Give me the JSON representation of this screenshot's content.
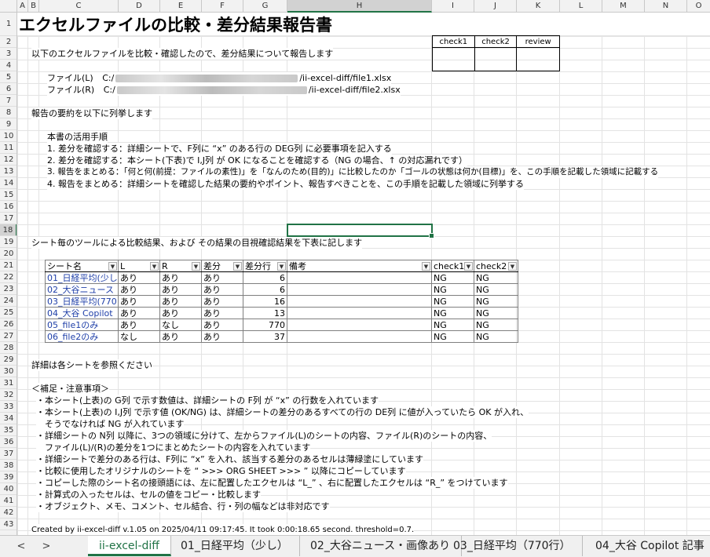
{
  "columns": [
    "A",
    "B",
    "C",
    "D",
    "E",
    "F",
    "G",
    "H",
    "I",
    "J",
    "K",
    "L",
    "M",
    "N",
    "O"
  ],
  "rows": [
    "1",
    "2",
    "3",
    "4",
    "5",
    "6",
    "7",
    "8",
    "9",
    "10",
    "11",
    "12",
    "13",
    "14",
    "15",
    "16",
    "17",
    "18",
    "19",
    "20",
    "21",
    "22",
    "23",
    "24",
    "25",
    "26",
    "27",
    "28",
    "29",
    "30",
    "31",
    "32",
    "33",
    "34",
    "35",
    "36",
    "37",
    "38",
    "39",
    "40",
    "41",
    "42",
    "43"
  ],
  "title": "エクセルファイルの比較・差分結果報告書",
  "intro": "以下のエクセルファイルを比較・確認したので、差分結果について報告します",
  "file_l_label": "ファイル(L)",
  "file_l_prefix": "C:/",
  "file_l_suffix": "/ii-excel-diff/file1.xlsx",
  "file_r_label": "ファイル(R)",
  "file_r_prefix": "C:/",
  "file_r_suffix": "/ii-excel-diff/file2.xlsx",
  "summary_intro": "報告の要約を以下に列挙します",
  "usage_head": "本書の活用手順",
  "usage": [
    "1. 差分を確認する：詳細シートで、F列に “x” のある行の DEG列 に必要事項を記入する",
    "2. 差分を確認する：本シート(下表)で I,J列 が OK になることを確認する（NG の場合、↑ の対応漏れです）",
    "3. 報告をまとめる：「何と何(前提：ファイルの素性)」を「なんのため(目的)」に比較したのか「ゴールの状態は何か(目標)」を、この手順を記載した領域に記載する",
    "4. 報告をまとめる：詳細シートを確認した結果の要約やポイント、報告すべきことを、この手順を記載した領域に列挙する"
  ],
  "review_box": {
    "headers": [
      "check1",
      "check2",
      "review"
    ]
  },
  "table_intro": "シート毎のツールによる比較結果、および その結果の目視確認結果を下表に記します",
  "table": {
    "headers": [
      "シート名",
      "L",
      "R",
      "差分",
      "差分行",
      "備考",
      "check1",
      "check2"
    ],
    "rows": [
      [
        "01_日経平均(少し)",
        "あり",
        "あり",
        "あり",
        "6",
        "",
        "NG",
        "NG"
      ],
      [
        "02_大谷ニュース",
        "あり",
        "あり",
        "あり",
        "6",
        "",
        "NG",
        "NG"
      ],
      [
        "03_日経平均(770",
        "あり",
        "あり",
        "あり",
        "16",
        "",
        "NG",
        "NG"
      ],
      [
        "04_大谷 Copilot",
        "あり",
        "あり",
        "あり",
        "13",
        "",
        "NG",
        "NG"
      ],
      [
        "05_file1のみ",
        "あり",
        "なし",
        "あり",
        "770",
        "",
        "NG",
        "NG"
      ],
      [
        "06_file2のみ",
        "なし",
        "あり",
        "あり",
        "37",
        "",
        "NG",
        "NG"
      ]
    ]
  },
  "details_note": "詳細は各シートを参照ください",
  "notes_head": "＜補足・注意事項＞",
  "notes": [
    "・本シート(上表)の G列 で示す数値は、詳細シートの F列 が “x” の行数を入れています",
    "・本シート(上表)の I,J列 で示す値 (OK/NG) は、詳細シートの差分のあるすべての行の DE列 に値が入っていたら OK が入れ、",
    "　そうでなければ NG が入れています",
    "・詳細シートの N列 以降に、3つの領域に分けて、左からファイル(L)のシートの内容、ファイル(R)のシートの内容、",
    "　ファイル(L)/(R)の差分を1つにまとめたシートの内容を入れています",
    "・詳細シートで差分のある行は、F列に “x” を入れ、該当する差分のあるセルは薄緑塗にしています",
    "・比較に使用したオリジナルのシートを “ >>> ORG SHEET >>> ” 以降にコピーしています",
    "・コピーした際のシート名の接頭語には、左に配置したエクセルは “L_” 、右に配置したエクセルは “R_” をつけています",
    "・計算式の入ったセルは、セルの値をコピー・比較します",
    "・オブジェクト、メモ、コメント、セル結合、行・列の幅などは非対応です"
  ],
  "footer": "Created by ii-excel-diff v.1.05 on 2025/04/11 09:17:45. It took 0:00:18.65 second. threshold=0.7.",
  "tabs": [
    "ii-excel-diff",
    "01_日経平均（少し）",
    "02_大谷ニュース・画像あり",
    "03_日経平均（770行）",
    "04_大谷 Copilot 記事"
  ],
  "nav": {
    "prev": "<",
    "next": ">"
  }
}
